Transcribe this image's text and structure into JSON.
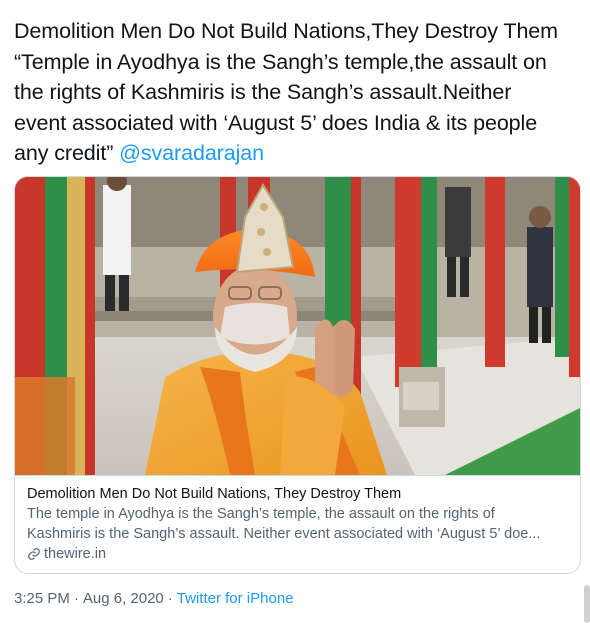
{
  "tweet": {
    "text_lines": [
      "Demolition Men Do Not Build Nations,They Destroy Them",
      "“Temple in Ayodhya is the Sangh’s temple,the assault on",
      "the rights of Kashmiris is the Sangh’s assault.Neither",
      "event associated with ‘August 5’ does India & its people",
      "any credit”"
    ],
    "mention": "@svaradarajan"
  },
  "card": {
    "image_alt": "Photo of a man in saffron attire and an embellished headdress with folded hands at a temple",
    "title": "Demolition Men Do Not Build Nations, They Destroy Them",
    "description_lines": [
      "The temple in Ayodhya is the Sangh’s temple, the assault on the rights of",
      "Kashmiris is the Sangh’s assault. Neither event associated with ‘August 5’ doe..."
    ],
    "domain": "thewire.in",
    "link_icon": "link-icon"
  },
  "meta": {
    "time": "3:25 PM",
    "separator": "·",
    "date": "Aug 6, 2020",
    "source": "Twitter for iPhone"
  },
  "colors": {
    "text": "#0f1419",
    "secondary": "#536471",
    "link": "#1d9bf0",
    "border": "#cfd9de"
  }
}
